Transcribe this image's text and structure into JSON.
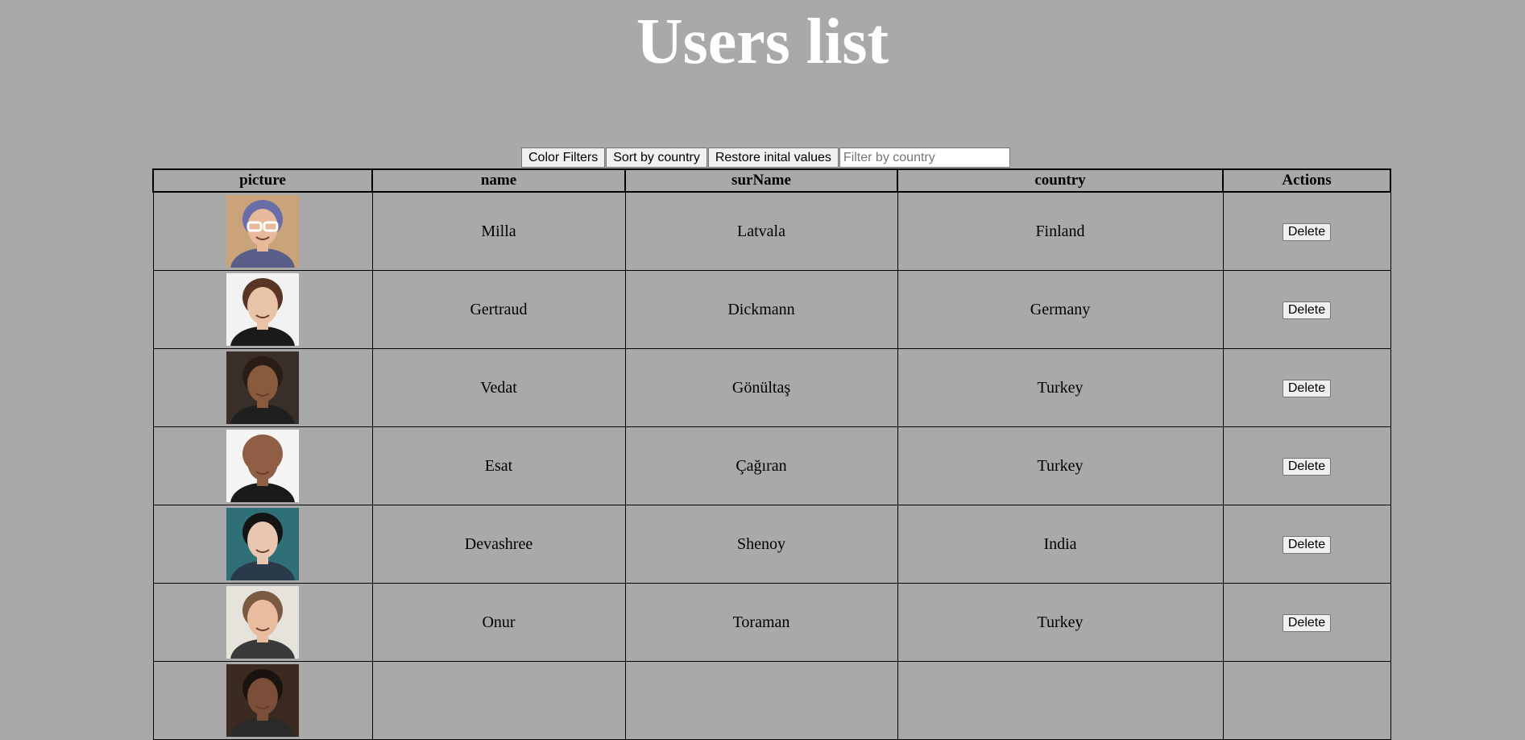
{
  "page": {
    "title": "Users list"
  },
  "toolbar": {
    "color_filters_label": "Color Filters",
    "sort_label": "Sort by country",
    "restore_label": "Restore inital values",
    "filter_placeholder": "Filter by country",
    "filter_value": ""
  },
  "table": {
    "headers": {
      "picture": "picture",
      "name": "name",
      "surname": "surName",
      "country": "country",
      "actions": "Actions"
    },
    "rows": [
      {
        "name": "Milla",
        "surname": "Latvala",
        "country": "Finland",
        "action": "Delete",
        "avatar": {
          "bg": "#c9a47a",
          "skin": "#e7b89a",
          "hair": "#6a6ea8",
          "shirt": "#5a5f8a",
          "glasses": true
        }
      },
      {
        "name": "Gertraud",
        "surname": "Dickmann",
        "country": "Germany",
        "action": "Delete",
        "avatar": {
          "bg": "#f2f2f2",
          "skin": "#e9c3a8",
          "hair": "#5a3424",
          "shirt": "#1a1a1a",
          "glasses": false
        }
      },
      {
        "name": "Vedat",
        "surname": "Gönültaş",
        "country": "Turkey",
        "action": "Delete",
        "avatar": {
          "bg": "#3a2e28",
          "skin": "#8a5a3e",
          "hair": "#2a1d16",
          "shirt": "#1f1f1f",
          "glasses": false
        }
      },
      {
        "name": "Esat",
        "surname": "Çağıran",
        "country": "Turkey",
        "action": "Delete",
        "avatar": {
          "bg": "#f5f5f5",
          "skin": "#8f5e44",
          "hair": "#8f5e44",
          "shirt": "#1a1a1a",
          "glasses": false
        }
      },
      {
        "name": "Devashree",
        "surname": "Shenoy",
        "country": "India",
        "action": "Delete",
        "avatar": {
          "bg": "#2f6f78",
          "skin": "#e8c6b0",
          "hair": "#141414",
          "shirt": "#2a3a4a",
          "glasses": false
        }
      },
      {
        "name": "Onur",
        "surname": "Toraman",
        "country": "Turkey",
        "action": "Delete",
        "avatar": {
          "bg": "#e6e2dc",
          "skin": "#e9bca0",
          "hair": "#7a5a40",
          "shirt": "#3a3a3a",
          "glasses": false
        }
      },
      {
        "name": "",
        "surname": "",
        "country": "",
        "action": "",
        "avatar": {
          "bg": "#3a2a22",
          "skin": "#7a4e38",
          "hair": "#1a120e",
          "shirt": "#2a2a2a",
          "glasses": false
        }
      }
    ]
  }
}
